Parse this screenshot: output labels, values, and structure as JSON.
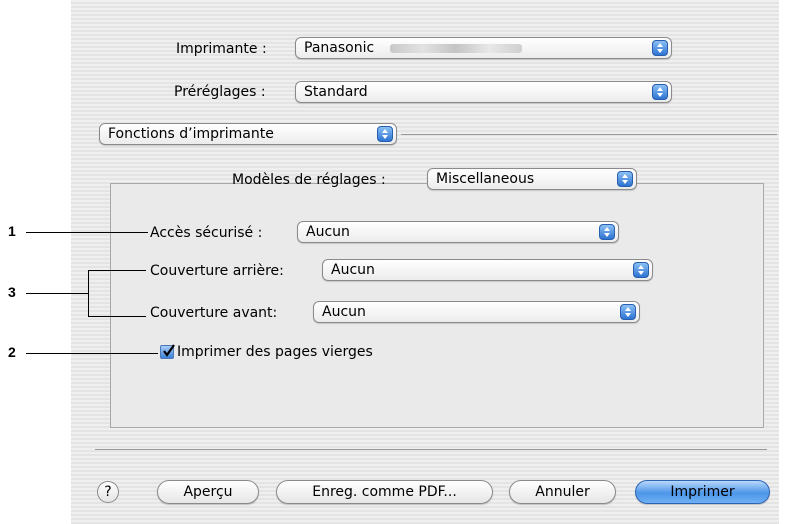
{
  "printer": {
    "label": "Imprimante :",
    "value": "Panasonic"
  },
  "presets": {
    "label": "Préréglages :",
    "value": "Standard"
  },
  "section": {
    "value": "Fonctions d’imprimante"
  },
  "settings_group": {
    "label": "Modèles de réglages :",
    "value": "Miscellaneous"
  },
  "secure_access": {
    "label": "Accès sécurisé :",
    "value": "Aucun"
  },
  "back_cover": {
    "label": "Couverture arrière:",
    "value": "Aucun"
  },
  "front_cover": {
    "label": "Couverture avant:",
    "value": "Aucun"
  },
  "blank_pages": {
    "label": "Imprimer des pages vierges",
    "checked": true
  },
  "buttons": {
    "help": "?",
    "preview": "Aperçu",
    "save_pdf": "Enreg. comme PDF...",
    "cancel": "Annuler",
    "print": "Imprimer"
  },
  "callouts": {
    "c1": "1",
    "c2": "2",
    "c3": "3"
  },
  "colors": {
    "accent": "#3d82d9",
    "default_button": "#4d95e8"
  }
}
